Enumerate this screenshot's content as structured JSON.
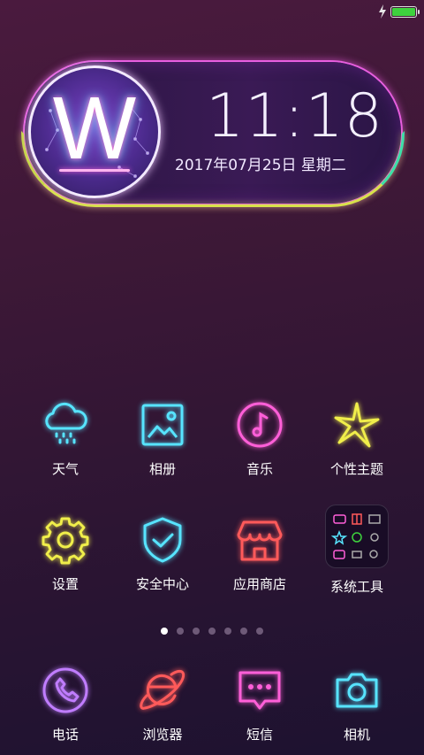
{
  "status_bar": {
    "battery_percent": 100,
    "charging": true
  },
  "clock_widget": {
    "avatar_letter": "W",
    "time": "11:18",
    "date": "2017年07月25日  星期二"
  },
  "apps": [
    {
      "label": "天气",
      "icon": "weather-icon"
    },
    {
      "label": "相册",
      "icon": "gallery-icon"
    },
    {
      "label": "音乐",
      "icon": "music-icon"
    },
    {
      "label": "个性主题",
      "icon": "theme-icon"
    },
    {
      "label": "设置",
      "icon": "settings-gear-icon"
    },
    {
      "label": "安全中心",
      "icon": "security-shield-icon"
    },
    {
      "label": "应用商店",
      "icon": "app-store-icon"
    },
    {
      "label": "系统工具",
      "icon": "system-tools-folder-icon"
    }
  ],
  "page_indicator": {
    "total": 7,
    "active": 1
  },
  "dock": [
    {
      "label": "电话",
      "icon": "phone-icon"
    },
    {
      "label": "浏览器",
      "icon": "browser-icon"
    },
    {
      "label": "短信",
      "icon": "messages-icon"
    },
    {
      "label": "相机",
      "icon": "camera-icon"
    }
  ],
  "colors": {
    "neon_cyan": "#57e4ff",
    "neon_pink": "#ff5fd8",
    "neon_yellow": "#f0ee4a",
    "neon_red": "#ff5a5a"
  }
}
